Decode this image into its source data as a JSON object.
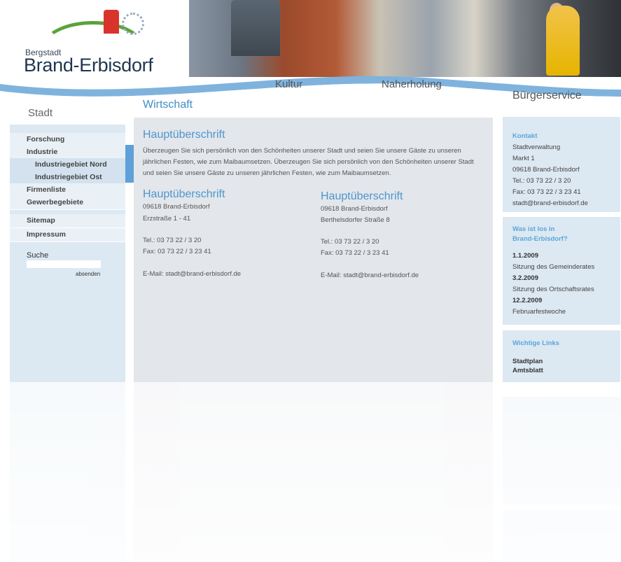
{
  "logo": {
    "small": "Bergstadt",
    "big": "Brand-Erbisdorf"
  },
  "nav": {
    "kultur": "Kultur",
    "naherholung": "Naherholung",
    "buergerservice": "Bürgerservice",
    "stadt": "Stadt"
  },
  "breadcrumb": "Wirtschaft",
  "sidebar": {
    "items": [
      {
        "label": "Forschung"
      },
      {
        "label": "Industrie"
      },
      {
        "label": "Industriegebiet Nord"
      },
      {
        "label": "Industriegebiet Ost"
      },
      {
        "label": "Firmenliste"
      },
      {
        "label": "Gewerbegebiete"
      },
      {
        "label": "Sitemap"
      },
      {
        "label": "Impressum"
      }
    ],
    "search_label": "Suche",
    "search_button": "absenden"
  },
  "main": {
    "title": "Hauptüberschrift",
    "text": "Überzeugen Sie sich persönlich von den Schönheiten unserer Stadt und seien Sie unsere Gäste zu unseren jährlichen Festen, wie zum Maibaumsetzen. Überzeugen Sie sich persönlich von den Schönheiten unserer Stadt und seien Sie unsere Gäste zu unseren jährlichen Festen, wie zum Maibaumsetzen.",
    "col1": {
      "title": "Hauptüberschrift",
      "city": "09618 Brand-Erbisdorf",
      "street": "Erzstraße 1 - 41",
      "tel": "Tel.: 03 73 22 / 3 20",
      "fax": "Fax: 03 73 22 / 3 23 41",
      "email": "E-Mail: stadt@brand-erbisdorf.de"
    },
    "col2": {
      "title": "Hauptüberschrift",
      "city": "09618 Brand-Erbisdorf",
      "street": "Berthelsdorfer Straße 8",
      "tel": "Tel.: 03 73 22 / 3 20",
      "fax": "Fax: 03 73 22 / 3 23 41",
      "email": "E-Mail: stadt@brand-erbisdorf.de"
    }
  },
  "right": {
    "kontakt": {
      "title": "Kontakt",
      "lines": [
        "Stadtverwaltung",
        "Markt 1",
        "09618 Brand-Erbisdorf",
        "Tel.: 03 73 22 / 3 20",
        "Fax: 03 73 22 / 3 23 41",
        "stadt@brand-erbisdorf.de"
      ]
    },
    "events": {
      "title1": "Was ist los in",
      "title2": "Brand-Erbisdorf?",
      "items": [
        {
          "date": "1.1.2009",
          "text": "Sitzung des Gemeinderates"
        },
        {
          "date": "3.2.2009",
          "text": "Sitzung des Ortschaftsrates"
        },
        {
          "date": "12.2.2009",
          "text": "Februarfestwoche"
        }
      ]
    },
    "links": {
      "title": "Wichtige Links",
      "items": [
        "Stadtplan",
        "Amtsblatt"
      ]
    }
  }
}
